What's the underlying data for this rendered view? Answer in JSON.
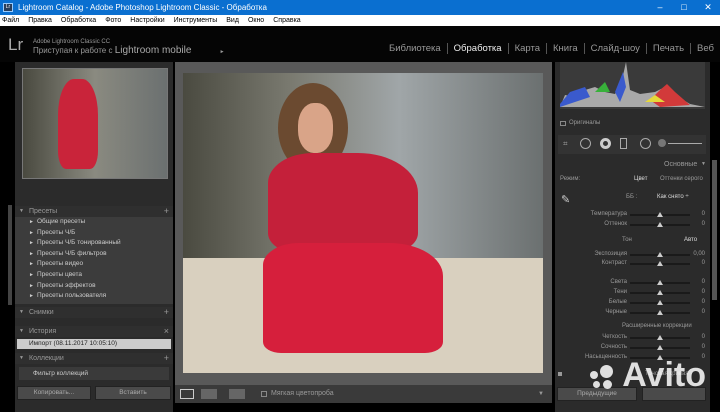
{
  "window": {
    "title": "Lightroom Catalog - Adobe Photoshop Lightroom Classic - Обработка",
    "app_icon": "Lr",
    "minimize": "–",
    "maximize": "□",
    "close": "✕"
  },
  "menu": [
    "Файл",
    "Правка",
    "Обработка",
    "Фото",
    "Настройки",
    "Инструменты",
    "Вид",
    "Окно",
    "Справка"
  ],
  "identity": {
    "logo": "Lr",
    "product": "Adobe Lightroom Classic CC",
    "prompt_prefix": "Приступая к работе с",
    "prompt_brand": "Lightroom mobile",
    "arrow": "►"
  },
  "modules": [
    {
      "label": "Библиотека",
      "active": false
    },
    {
      "label": "Обработка",
      "active": true
    },
    {
      "label": "Карта",
      "active": false
    },
    {
      "label": "Книга",
      "active": false
    },
    {
      "label": "Слайд-шоу",
      "active": false
    },
    {
      "label": "Печать",
      "active": false
    },
    {
      "label": "Веб",
      "active": false
    }
  ],
  "left": {
    "presets": {
      "title": "Пресеты",
      "add": "+",
      "items": [
        "Общие пресеты",
        "Пресеты Ч/Б",
        "Пресеты Ч/Б тонированный",
        "Пресеты Ч/Б фильтров",
        "Пресеты видео",
        "Пресеты цвета",
        "Пресеты эффектов",
        "Пресеты пользователя"
      ]
    },
    "snapshots": {
      "title": "Снимки",
      "add": "+"
    },
    "history": {
      "title": "История",
      "clear": "×",
      "items": [
        "Импорт (08.11.2017 10:05:10)"
      ]
    },
    "collections": {
      "title": "Коллекции",
      "add": "+",
      "filter": "Фильтр коллекций"
    },
    "copy_button": "Копировать...",
    "paste_button": "Вставить"
  },
  "toolbar": {
    "soft_proof": "Мягкая цветопроба",
    "soft_proof_checked": false
  },
  "right": {
    "histogram_original": "Оригиналы",
    "panel_title": "Основные",
    "treatment_label": "Режим:",
    "treatment_color": "Цвет",
    "treatment_bw": "Оттенки серого",
    "wb_label": "ББ :",
    "wb_value": "Как снято ÷",
    "tone_label": "Тон",
    "auto": "Авто",
    "presence_label": "Расширенные коррекции",
    "sliders": [
      {
        "label": "Температура",
        "value": "0"
      },
      {
        "label": "Оттенок",
        "value": "0"
      },
      {
        "label": "Экспозиция",
        "value": "0,00"
      },
      {
        "label": "Контраст",
        "value": "0"
      },
      {
        "label": "Света",
        "value": "0"
      },
      {
        "label": "Тени",
        "value": "0"
      },
      {
        "label": "Белые",
        "value": "0"
      },
      {
        "label": "Черные",
        "value": "0"
      },
      {
        "label": "Четкость",
        "value": "0"
      },
      {
        "label": "Сочность",
        "value": "0"
      },
      {
        "label": "Насыщенность",
        "value": "0"
      }
    ],
    "tone_curve": "Тоновая кривая",
    "previous_button": "Предыдущие"
  },
  "watermark": "Avito"
}
